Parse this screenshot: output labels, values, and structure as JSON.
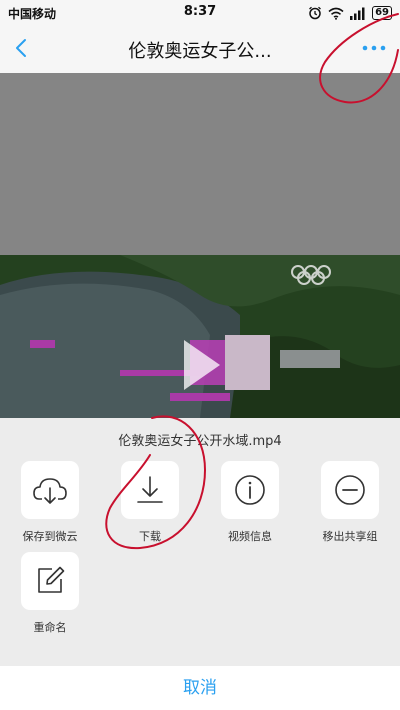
{
  "status_bar": {
    "carrier": "中国移动",
    "time": "8:37",
    "battery": "69"
  },
  "nav": {
    "title": "伦敦奥运女子公..."
  },
  "file": {
    "name": "伦敦奥运女子公开水域.mp4"
  },
  "actions": [
    {
      "label": "保存到微云",
      "icon": "cloud-download-icon"
    },
    {
      "label": "下载",
      "icon": "download-icon"
    },
    {
      "label": "视频信息",
      "icon": "info-icon"
    },
    {
      "label": "移出共享组",
      "icon": "minus-circle-icon"
    },
    {
      "label": "重命名",
      "icon": "edit-icon"
    }
  ],
  "cancel_label": "取消",
  "colors": {
    "accent": "#2aa0f0",
    "annotation": "#c8102e"
  }
}
